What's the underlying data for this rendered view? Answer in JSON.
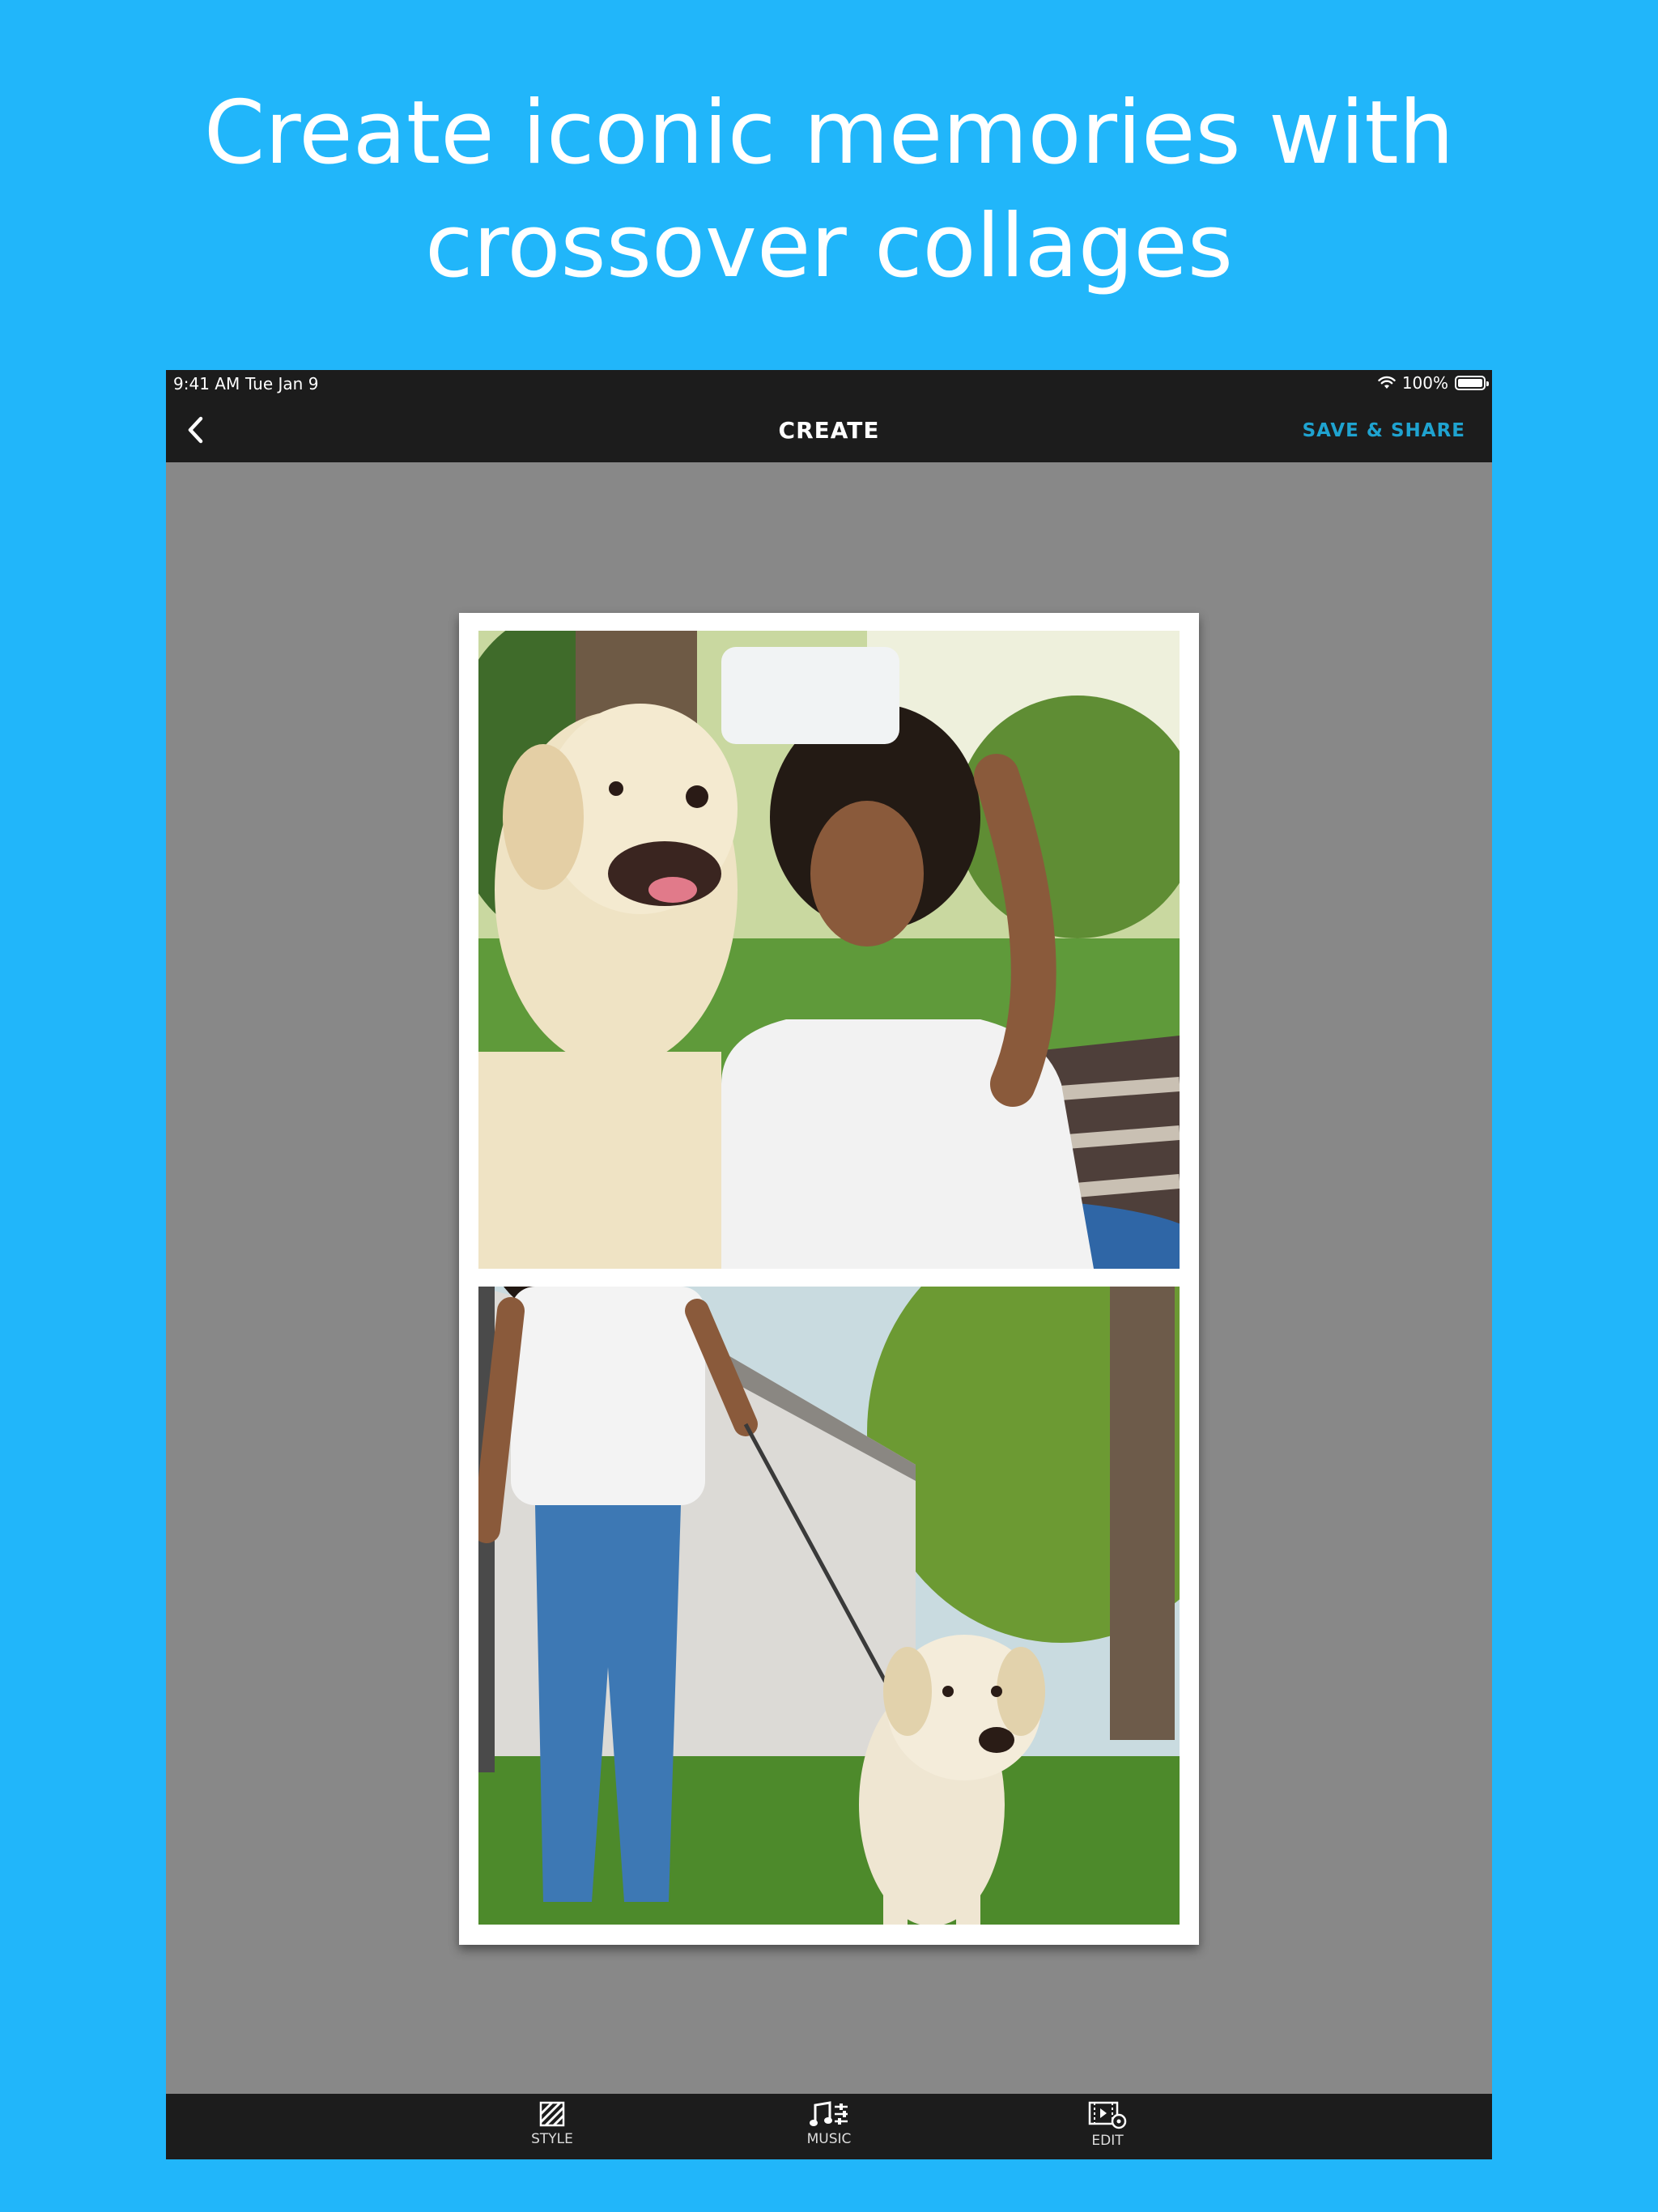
{
  "headline": "Create iconic memories with crossover collages",
  "status_bar": {
    "time": "9:41 AM",
    "date": "Tue Jan 9",
    "battery": "100%"
  },
  "nav": {
    "title": "CREATE",
    "action": "SAVE & SHARE"
  },
  "tabs": [
    {
      "label": "STYLE",
      "icon": "style-icon"
    },
    {
      "label": "MUSIC",
      "icon": "music-icon"
    },
    {
      "label": "EDIT",
      "icon": "edit-icon"
    }
  ],
  "colors": {
    "background": "#21b6fa",
    "bars": "#1c1c1c",
    "canvas": "#888888",
    "accent": "#1fa3d0"
  }
}
